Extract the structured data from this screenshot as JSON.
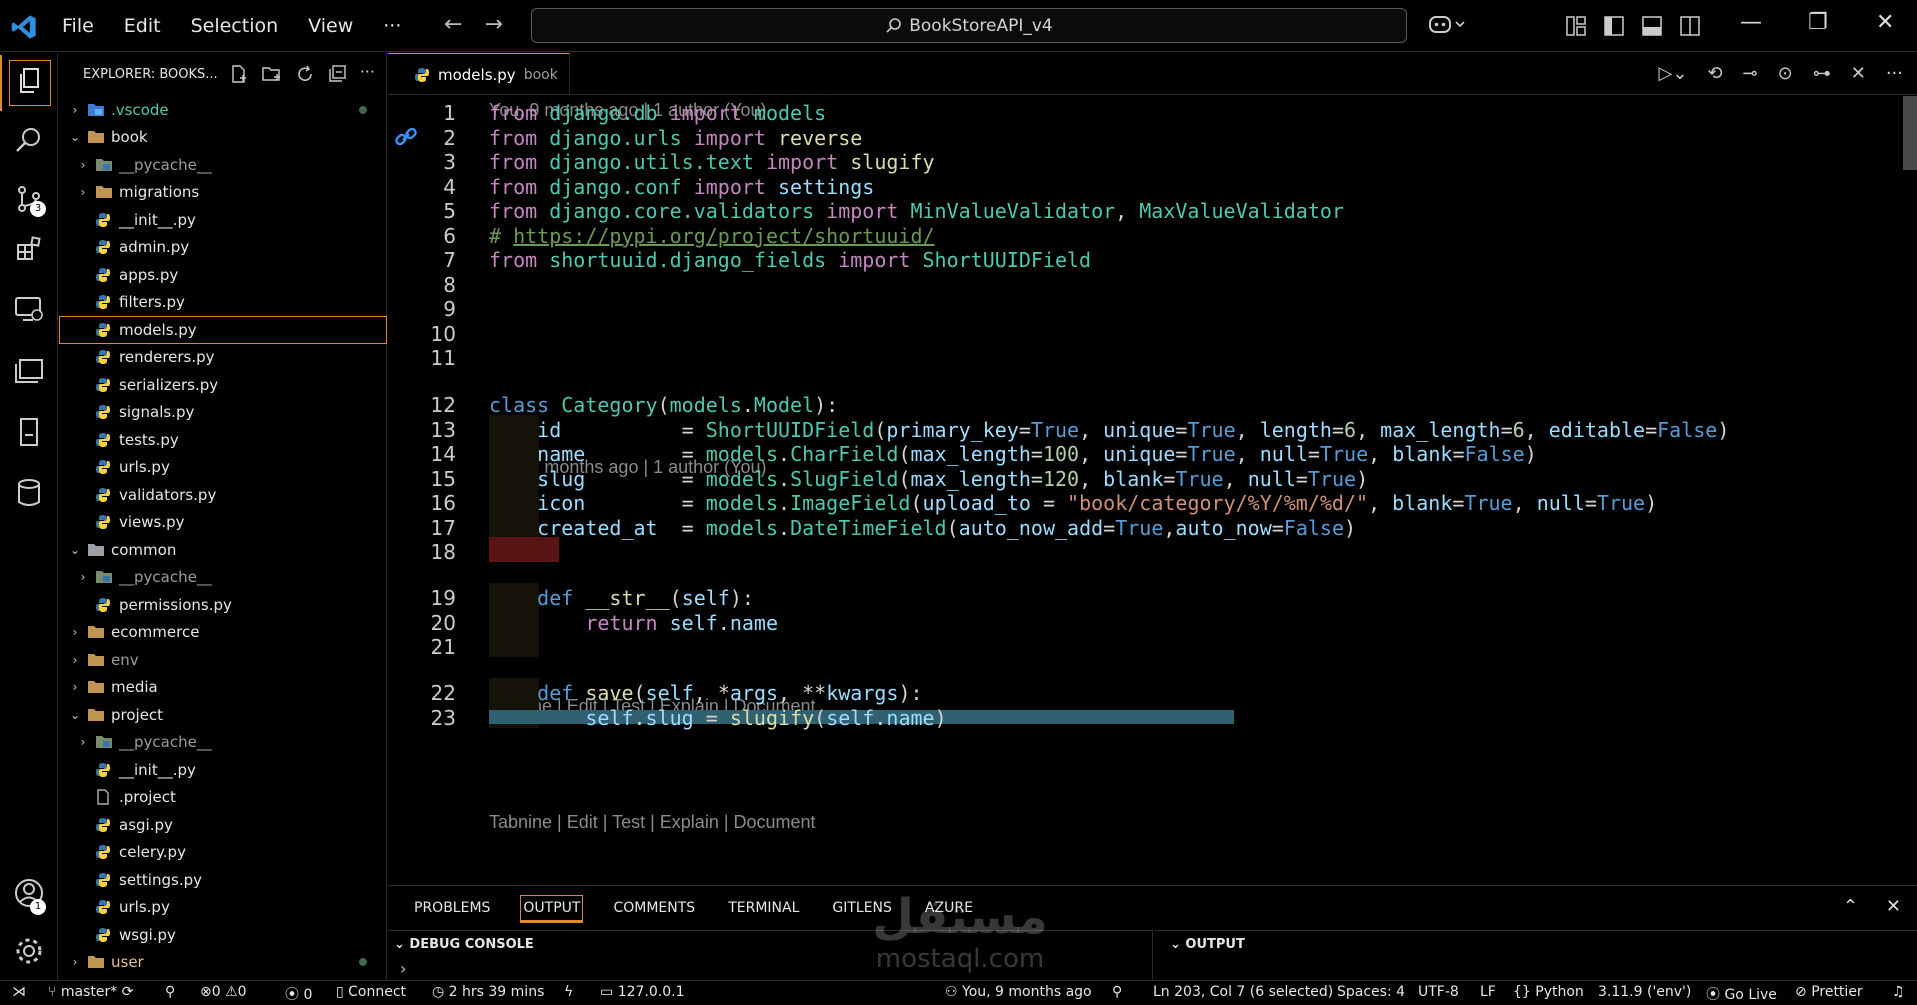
{
  "titlebar": {
    "menu": [
      "File",
      "Edit",
      "Selection",
      "View",
      "···"
    ],
    "search_text": "BookStoreAPI_v4"
  },
  "activity_badges": {
    "source_control": "3",
    "accounts": "1"
  },
  "sidebar": {
    "title": "EXPLORER: BOOKS...",
    "items": [
      {
        "label": ".vscode",
        "depth": 0,
        "type": "folder-vscode",
        "chev": "›",
        "cls": "teal",
        "dot": true
      },
      {
        "label": "book",
        "depth": 0,
        "type": "folder",
        "chev": "⌄"
      },
      {
        "label": "__pycache__",
        "depth": 1,
        "type": "folder-py",
        "chev": "›",
        "cls": "dim"
      },
      {
        "label": "migrations",
        "depth": 1,
        "type": "folder",
        "chev": "›"
      },
      {
        "label": "__init__.py",
        "depth": 1,
        "type": "py"
      },
      {
        "label": "admin.py",
        "depth": 1,
        "type": "py"
      },
      {
        "label": "apps.py",
        "depth": 1,
        "type": "py"
      },
      {
        "label": "filters.py",
        "depth": 1,
        "type": "py"
      },
      {
        "label": "models.py",
        "depth": 1,
        "type": "py",
        "selected": true
      },
      {
        "label": "renderers.py",
        "depth": 1,
        "type": "py"
      },
      {
        "label": "serializers.py",
        "depth": 1,
        "type": "py"
      },
      {
        "label": "signals.py",
        "depth": 1,
        "type": "py"
      },
      {
        "label": "tests.py",
        "depth": 1,
        "type": "py"
      },
      {
        "label": "urls.py",
        "depth": 1,
        "type": "py"
      },
      {
        "label": "validators.py",
        "depth": 1,
        "type": "py"
      },
      {
        "label": "views.py",
        "depth": 1,
        "type": "py"
      },
      {
        "label": "common",
        "depth": 0,
        "type": "folder-common",
        "chev": "⌄"
      },
      {
        "label": "__pycache__",
        "depth": 1,
        "type": "folder-py",
        "chev": "›",
        "cls": "dim"
      },
      {
        "label": "permissions.py",
        "depth": 1,
        "type": "py"
      },
      {
        "label": "ecommerce",
        "depth": 0,
        "type": "folder",
        "chev": "›"
      },
      {
        "label": "env",
        "depth": 0,
        "type": "folder",
        "chev": "›",
        "cls": "dim"
      },
      {
        "label": "media",
        "depth": 0,
        "type": "folder",
        "chev": "›"
      },
      {
        "label": "project",
        "depth": 0,
        "type": "folder",
        "chev": "⌄"
      },
      {
        "label": "__pycache__",
        "depth": 1,
        "type": "folder-py",
        "chev": "›",
        "cls": "dim"
      },
      {
        "label": "__init__.py",
        "depth": 1,
        "type": "py"
      },
      {
        "label": ".project",
        "depth": 1,
        "type": "file"
      },
      {
        "label": "asgi.py",
        "depth": 1,
        "type": "py"
      },
      {
        "label": "celery.py",
        "depth": 1,
        "type": "py"
      },
      {
        "label": "settings.py",
        "depth": 1,
        "type": "py"
      },
      {
        "label": "urls.py",
        "depth": 1,
        "type": "py"
      },
      {
        "label": "wsgi.py",
        "depth": 1,
        "type": "py"
      },
      {
        "label": "user",
        "depth": 0,
        "type": "folder",
        "chev": "›",
        "cls": "gold",
        "dot": true
      }
    ]
  },
  "editor": {
    "tab_label": "models.py",
    "tab_dir": "book",
    "blame_1": "You, 9 months ago | 1 author (You)",
    "blame_2": "You, 9 months ago | 1 author (You)",
    "lens_1": "Tabnine | Edit | Test | Explain | Document",
    "lens_2": "Tabnine | Edit | Test | Explain | Document",
    "lines": [
      {
        "n": "1",
        "tokens": [
          [
            "from ",
            "kw"
          ],
          [
            "django.db ",
            "mod"
          ],
          [
            "import ",
            "kw"
          ],
          [
            "models",
            "mod"
          ]
        ]
      },
      {
        "n": "2",
        "tokens": [
          [
            "from ",
            "kw"
          ],
          [
            "django.urls ",
            "mod"
          ],
          [
            "import ",
            "kw"
          ],
          [
            "reverse",
            "fn"
          ]
        ]
      },
      {
        "n": "3",
        "tokens": [
          [
            "from ",
            "kw"
          ],
          [
            "django.utils.text ",
            "mod"
          ],
          [
            "import ",
            "kw"
          ],
          [
            "slugify",
            "fn"
          ]
        ]
      },
      {
        "n": "4",
        "tokens": [
          [
            "from ",
            "kw"
          ],
          [
            "django.conf ",
            "mod"
          ],
          [
            "import ",
            "kw"
          ],
          [
            "settings",
            "var"
          ]
        ]
      },
      {
        "n": "5",
        "tokens": [
          [
            "from ",
            "kw"
          ],
          [
            "django.core.validators ",
            "mod"
          ],
          [
            "import ",
            "kw"
          ],
          [
            "MinValueValidator",
            "mod"
          ],
          [
            ", ",
            ""
          ],
          [
            "MaxValueValidator",
            "mod"
          ]
        ]
      },
      {
        "n": "6",
        "tokens": [
          [
            "# ",
            "com"
          ],
          [
            "https://pypi.org/project/shortuuid/",
            "com-u"
          ]
        ]
      },
      {
        "n": "7",
        "tokens": [
          [
            "from ",
            "kw"
          ],
          [
            "shortuuid.django_fields ",
            "mod"
          ],
          [
            "import ",
            "kw"
          ],
          [
            "ShortUUIDField",
            "mod"
          ]
        ]
      },
      {
        "n": "8",
        "tokens": []
      },
      {
        "n": "9",
        "tokens": []
      },
      {
        "n": "10",
        "tokens": []
      },
      {
        "n": "11",
        "tokens": []
      },
      {
        "n": "12",
        "tokens": [
          [
            "class ",
            "def"
          ],
          [
            "Category",
            "mod"
          ],
          [
            "(",
            ""
          ],
          [
            "models",
            "mod"
          ],
          [
            ".",
            ""
          ],
          [
            "Model",
            "mod"
          ],
          [
            "):",
            ""
          ]
        ]
      },
      {
        "n": "13",
        "tokens": [
          [
            "    ",
            ""
          ],
          [
            "id",
            "var"
          ],
          [
            "          = ",
            ""
          ],
          [
            "ShortUUIDField",
            "mod"
          ],
          [
            "(",
            ""
          ],
          [
            "primary_key",
            "var"
          ],
          [
            "=",
            ""
          ],
          [
            "True",
            "bool"
          ],
          [
            ", ",
            ""
          ],
          [
            "unique",
            "var"
          ],
          [
            "=",
            ""
          ],
          [
            "True",
            "bool"
          ],
          [
            ", ",
            ""
          ],
          [
            "length",
            "var"
          ],
          [
            "=",
            ""
          ],
          [
            "6",
            "num"
          ],
          [
            ", ",
            ""
          ],
          [
            "max_length",
            "var"
          ],
          [
            "=",
            ""
          ],
          [
            "6",
            "num"
          ],
          [
            ", ",
            ""
          ],
          [
            "editable",
            "var"
          ],
          [
            "=",
            ""
          ],
          [
            "False",
            "bool"
          ],
          [
            ")",
            ""
          ]
        ]
      },
      {
        "n": "14",
        "tokens": [
          [
            "    ",
            ""
          ],
          [
            "name",
            "var"
          ],
          [
            "        = ",
            ""
          ],
          [
            "models",
            "mod"
          ],
          [
            ".",
            ""
          ],
          [
            "CharField",
            "mod"
          ],
          [
            "(",
            ""
          ],
          [
            "max_length",
            "var"
          ],
          [
            "=",
            ""
          ],
          [
            "100",
            "num"
          ],
          [
            ", ",
            ""
          ],
          [
            "unique",
            "var"
          ],
          [
            "=",
            ""
          ],
          [
            "True",
            "bool"
          ],
          [
            ", ",
            ""
          ],
          [
            "null",
            "var"
          ],
          [
            "=",
            ""
          ],
          [
            "True",
            "bool"
          ],
          [
            ", ",
            ""
          ],
          [
            "blank",
            "var"
          ],
          [
            "=",
            ""
          ],
          [
            "False",
            "bool"
          ],
          [
            ")",
            ""
          ]
        ]
      },
      {
        "n": "15",
        "tokens": [
          [
            "    ",
            ""
          ],
          [
            "slug",
            "var"
          ],
          [
            "        = ",
            ""
          ],
          [
            "models",
            "mod"
          ],
          [
            ".",
            ""
          ],
          [
            "SlugField",
            "mod"
          ],
          [
            "(",
            ""
          ],
          [
            "max_length",
            "var"
          ],
          [
            "=",
            ""
          ],
          [
            "120",
            "num"
          ],
          [
            ", ",
            ""
          ],
          [
            "blank",
            "var"
          ],
          [
            "=",
            ""
          ],
          [
            "True",
            "bool"
          ],
          [
            ", ",
            ""
          ],
          [
            "null",
            "var"
          ],
          [
            "=",
            ""
          ],
          [
            "True",
            "bool"
          ],
          [
            ")",
            ""
          ]
        ]
      },
      {
        "n": "16",
        "tokens": [
          [
            "    ",
            ""
          ],
          [
            "icon",
            "var"
          ],
          [
            "        = ",
            ""
          ],
          [
            "models",
            "mod"
          ],
          [
            ".",
            ""
          ],
          [
            "ImageField",
            "mod"
          ],
          [
            "(",
            ""
          ],
          [
            "upload_to",
            "var"
          ],
          [
            " = ",
            ""
          ],
          [
            "\"book/category/%Y/%m/%d/\"",
            "str"
          ],
          [
            ", ",
            ""
          ],
          [
            "blank",
            "var"
          ],
          [
            "=",
            ""
          ],
          [
            "True",
            "bool"
          ],
          [
            ", ",
            ""
          ],
          [
            "null",
            "var"
          ],
          [
            "=",
            ""
          ],
          [
            "True",
            "bool"
          ],
          [
            ")",
            ""
          ]
        ]
      },
      {
        "n": "17",
        "tokens": [
          [
            "    ",
            ""
          ],
          [
            "created_at",
            "var"
          ],
          [
            "  = ",
            ""
          ],
          [
            "models",
            "mod"
          ],
          [
            ".",
            ""
          ],
          [
            "DateTimeField",
            "mod"
          ],
          [
            "(",
            ""
          ],
          [
            "auto_now_add",
            "var"
          ],
          [
            "=",
            ""
          ],
          [
            "True",
            "bool"
          ],
          [
            ",",
            ""
          ],
          [
            "auto_now",
            "var"
          ],
          [
            "=",
            ""
          ],
          [
            "False",
            "bool"
          ],
          [
            ")",
            ""
          ]
        ]
      },
      {
        "n": "18",
        "tokens": []
      },
      {
        "n": "19",
        "tokens": [
          [
            "    ",
            ""
          ],
          [
            "def ",
            "def"
          ],
          [
            "__str__",
            "fn"
          ],
          [
            "(",
            ""
          ],
          [
            "self",
            "var"
          ],
          [
            "):",
            ""
          ]
        ]
      },
      {
        "n": "20",
        "tokens": [
          [
            "        ",
            ""
          ],
          [
            "return ",
            "kw"
          ],
          [
            "self",
            "var"
          ],
          [
            ".",
            ""
          ],
          [
            "name",
            "var"
          ]
        ]
      },
      {
        "n": "21",
        "tokens": []
      },
      {
        "n": "22",
        "tokens": [
          [
            "    ",
            ""
          ],
          [
            "def ",
            "def"
          ],
          [
            "save",
            "fn"
          ],
          [
            "(",
            ""
          ],
          [
            "self",
            "var"
          ],
          [
            ", *",
            ""
          ],
          [
            "args",
            "var"
          ],
          [
            ", **",
            ""
          ],
          [
            "kwargs",
            "var"
          ],
          [
            "):",
            ""
          ]
        ]
      },
      {
        "n": "23",
        "tokens": [
          [
            "        ",
            ""
          ],
          [
            "self",
            "var"
          ],
          [
            ".",
            ""
          ],
          [
            "slug",
            "var"
          ],
          [
            " = ",
            ""
          ],
          [
            "slugify",
            "fn"
          ],
          [
            "(",
            ""
          ],
          [
            "self",
            "var"
          ],
          [
            ".",
            ""
          ],
          [
            "name",
            "var"
          ],
          [
            ")",
            ""
          ]
        ]
      }
    ]
  },
  "panel": {
    "tabs": [
      "PROBLEMS",
      "OUTPUT",
      "COMMENTS",
      "TERMINAL",
      "GITLENS",
      "AZURE"
    ],
    "active_tab": "OUTPUT",
    "debug_title": "DEBUG CONSOLE",
    "debug_prompt": "›",
    "output_title": "OUTPUT"
  },
  "statusbar": {
    "branch": "master*",
    "errors": "0",
    "warnings": "0",
    "ports": "0",
    "connect": "Connect",
    "time": "2 hrs 39 mins",
    "host": "127.0.0.1",
    "blame": "You, 9 months ago",
    "position": "Ln 203, Col 7 (6 selected)",
    "spaces": "Spaces: 4",
    "encoding": "UTF-8",
    "eol": "LF",
    "language": "Python",
    "interpreter": "3.11.9 ('env')",
    "golive": "Go Live",
    "prettier": "Prettier"
  },
  "watermark": {
    "arabic": "مستقل",
    "latin": "mostaql.com"
  },
  "colors": {
    "accent": "#e08a2c",
    "folder": "#c09553",
    "python_blue": "#3776ab",
    "python_yellow": "#ffd43b"
  }
}
